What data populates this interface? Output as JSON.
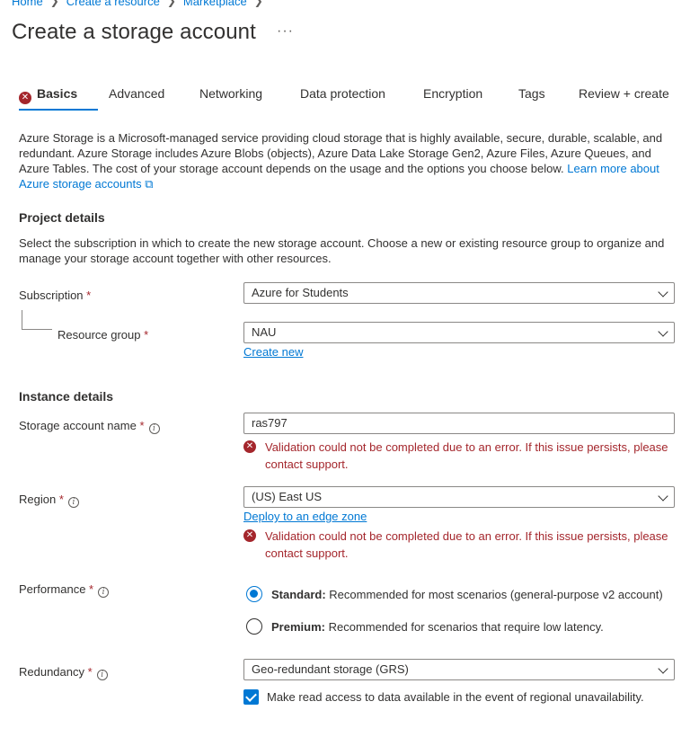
{
  "breadcrumb": [
    "Home",
    "Create a resource",
    "Marketplace"
  ],
  "page_title": "Create a storage account",
  "more_label": "···",
  "tabs": [
    "Basics",
    "Advanced",
    "Networking",
    "Data protection",
    "Encryption",
    "Tags",
    "Review + create"
  ],
  "intro": {
    "text": "Azure Storage is a Microsoft-managed service providing cloud storage that is highly available, secure, durable, scalable, and redundant. Azure Storage includes Azure Blobs (objects), Azure Data Lake Storage Gen2, Azure Files, Azure Queues, and Azure Tables. The cost of your storage account depends on the usage and the options you choose below.",
    "link": "Learn more about Azure storage accounts"
  },
  "project": {
    "title": "Project details",
    "desc": "Select the subscription in which to create the new storage account. Choose a new or existing resource group to organize and manage your storage account together with other resources.",
    "subscription_label": "Subscription",
    "subscription_value": "Azure for Students",
    "rg_label": "Resource group",
    "rg_value": "NAU",
    "create_new": "Create new"
  },
  "instance": {
    "title": "Instance details",
    "name_label": "Storage account name",
    "name_value": "ras797",
    "validation": "Validation could not be completed due to an error. If this issue persists, please contact support.",
    "region_label": "Region",
    "region_value": "(US) East US",
    "edge_zone_link": "Deploy to an edge zone",
    "performance_label": "Performance",
    "standard_title": "Standard:",
    "standard_desc": "Recommended for most scenarios (general-purpose v2 account)",
    "premium_title": "Premium:",
    "premium_desc": "Recommended for scenarios that require low latency.",
    "redundancy_label": "Redundancy",
    "redundancy_value": "Geo-redundant storage (GRS)",
    "read_access_label": "Make read access to data available in the event of regional unavailability."
  },
  "required_mark": "*",
  "icons": {
    "error": "error-circle-icon",
    "info": "info-icon",
    "chevron": "chevron-down-icon",
    "external": "external-link-icon"
  },
  "colors": {
    "accent": "#0078d4",
    "error": "#a4262c",
    "text": "#323130"
  }
}
